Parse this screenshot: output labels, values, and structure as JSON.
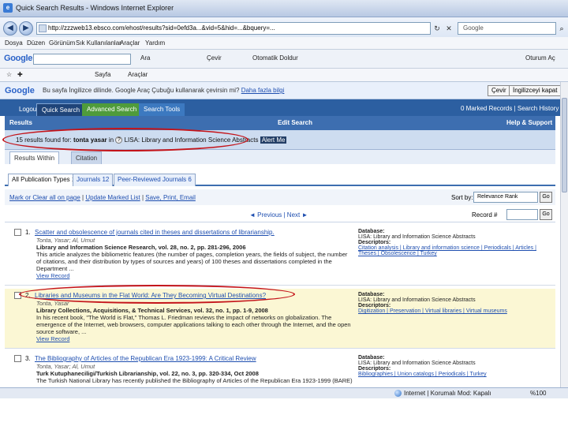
{
  "window": {
    "title": "Quick Search Results - Windows Internet Explorer"
  },
  "address": {
    "url": "http://zzzweb13.ebsco.com/ehost/results?sid=0efd3a...&vid=5&hid=...&bquery=...",
    "search_placeholder": "Google"
  },
  "menu": [
    "Dosya",
    "Düzen",
    "Görünüm",
    "Sık Kullanılanlar",
    "Araçlar",
    "Yardım"
  ],
  "google_toolbar": {
    "logo": "Google",
    "items": [
      "Ara",
      "Çevir",
      "Otomatik Doldur",
      "Oturum Aç"
    ]
  },
  "favorites_bar": {
    "items": [
      "Sayfa",
      "Araçlar"
    ]
  },
  "translate_bar": {
    "logo": "Google",
    "message": "Bu sayfa İngilizce dilinde. Google Araç Çubuğu kullanarak çevirsin mi?",
    "link": "Daha fazla bilgi",
    "translate_button": "Çevir",
    "close_button": "İngilizceyi kapat"
  },
  "ebsco_nav": {
    "logout": "Logout",
    "tabs": [
      "Quick Search",
      "Advanced Search",
      "Search Tools"
    ],
    "right": "0 Marked Records | Search History"
  },
  "section_bar": {
    "left": "Results",
    "center": "Edit Search",
    "right": "Help & Support"
  },
  "results_header": {
    "count_text": "15 results found for:",
    "query": "tonta yasar",
    "in_text": "in",
    "database": "LISA: Library and Information Science Abstracts",
    "alert": "Alert Me"
  },
  "view_tabs": [
    "Results Within",
    "Citation"
  ],
  "type_tabs": [
    "All Publication Types 15",
    "Journals 12",
    "Peer-Reviewed Journals 6"
  ],
  "tools": {
    "mark_clear": "Mark or Clear all on page",
    "update": "Update Marked List",
    "save": "Save, Print, Email",
    "sort_label": "Sort by:",
    "sort_value": "Relevance Rank",
    "go": "Go"
  },
  "pager": {
    "prev": "Previous",
    "next": "Next",
    "record_label": "Record #",
    "go": "Go"
  },
  "results": [
    {
      "num": "1.",
      "title": "Scatter and obsolescence of journals cited in theses and dissertations of librarianship.",
      "authors": "Tonta, Yasar; Al, Umut",
      "source": "Library and Information Science Research, vol. 28, no. 2, pp. 281-296, 2006",
      "abstract": [
        "This article analyzes the bibliometric features (the number of pages, completion years, the fields of subject, the number",
        "of citations, and their distribution by types of sources and years) of 100 theses and dissertations completed in the",
        "Department ..."
      ],
      "view": "View Record",
      "db_label": "Database:",
      "db_value": "LISA: Library and Information Science Abstracts",
      "desc_label": "Descriptors:",
      "descriptors": "Citation analysis | Library and information science | Periodicals | Articles | Theses | Obsolescence | Turkey"
    },
    {
      "num": "2.",
      "title": "Libraries and Museums in the Flat World: Are They Becoming Virtual Destinations?",
      "authors": "Tonta, Yasar",
      "source": "Library Collections, Acquisitions, & Technical Services, vol. 32, no. 1, pp. 1-9, 2008",
      "abstract": [
        "In his recent book, \"The World is Flat,\" Thomas L. Friedman reviews the impact of networks on globalization. The",
        "emergence of the Internet, web browsers, computer applications talking to each other through the Internet, and the open",
        "source software, ..."
      ],
      "view": "View Record",
      "db_label": "Database:",
      "db_value": "LISA: Library and Information Science Abstracts",
      "desc_label": "Descriptors:",
      "descriptors": "Digitization | Preservation | Virtual libraries | Virtual museums"
    },
    {
      "num": "3.",
      "title": "The Bibliography of Articles of the Republican Era 1923-1999: A Critical Review",
      "authors": "Tonta, Yasar; Al, Umut",
      "source": "Turk Kutuphaneciligi/Turkish Librarianship, vol. 22, no. 3, pp. 320-334, Oct 2008",
      "abstract": [
        "The Turkish National Library has recently published the Bibliography of Articles of the Republican Era 1923-1999 (BARE)"
      ],
      "view": "",
      "db_label": "Database:",
      "db_value": "LISA: Library and Information Science Abstracts",
      "desc_label": "Descriptors:",
      "descriptors": "Bibliographies | Union catalogs | Periodicals | Turkey"
    }
  ],
  "status": {
    "zone": "Internet | Korumalı Mod: Kapalı",
    "zoom": "%100"
  },
  "colors": {
    "annotation": "#c4141a",
    "ebsco_blue": "#2c5fa1",
    "link": "#1f4fb0"
  }
}
